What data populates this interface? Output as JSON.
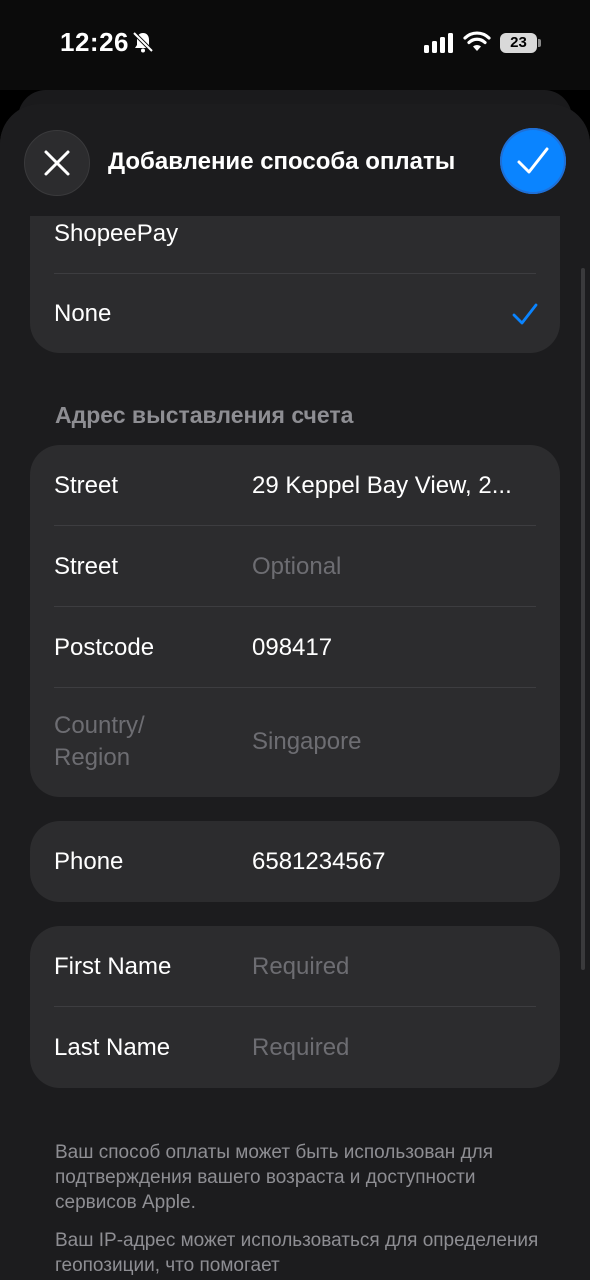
{
  "status_bar": {
    "time": "12:26",
    "battery": "23",
    "icons": [
      "bell-slash-icon",
      "cellular-signal-icon",
      "wifi-icon",
      "battery-icon"
    ]
  },
  "sheet": {
    "title": "Добавление способа оплаты",
    "close_icon": "close-icon",
    "done_icon": "checkmark-icon",
    "accent": "#0a84ff"
  },
  "payment_options": [
    {
      "label": "ShopeePay",
      "selected": false
    },
    {
      "label": "None",
      "selected": true
    }
  ],
  "billing": {
    "section_title": "Адрес выставления счета",
    "street1": {
      "label": "Street",
      "value": "29 Keppel Bay View, 2..."
    },
    "street2": {
      "label": "Street",
      "placeholder": "Optional"
    },
    "postcode": {
      "label": "Postcode",
      "value": "098417"
    },
    "country": {
      "label": "Country/\nRegion",
      "value": "Singapore"
    }
  },
  "phone": {
    "label": "Phone",
    "value": "6581234567"
  },
  "name": {
    "first": {
      "label": "First Name",
      "placeholder": "Required"
    },
    "last": {
      "label": "Last Name",
      "placeholder": "Required"
    }
  },
  "footnotes": [
    "Ваш способ оплаты может быть использован для подтверждения вашего возраста и доступности сервисов Apple.",
    "Ваш IP-адрес может использоваться для определения геопозиции, что помогает"
  ]
}
